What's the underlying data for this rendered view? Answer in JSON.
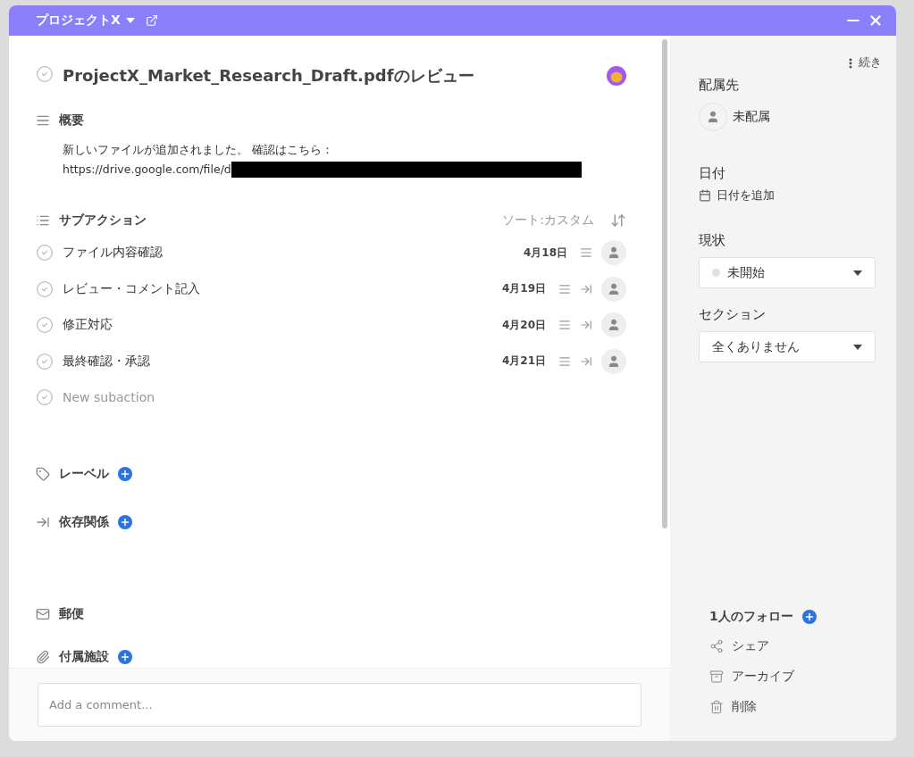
{
  "header": {
    "project": "プロジェクトX"
  },
  "task": {
    "title": "ProjectX_Market_Research_Draft.pdfのレビュー",
    "completed": false
  },
  "summary": {
    "label": "概要",
    "text": "新しいファイルが追加されました。 確認はこちら：",
    "link": "https://drive.google.com/file/d",
    "link_redacted": true
  },
  "subactions": {
    "label": "サブアクション",
    "sort": "ソート:カスタム",
    "new_placeholder": "New subaction",
    "items": [
      {
        "title": "ファイル内容確認",
        "date": "4月18日",
        "completed": false,
        "has_dependency": false
      },
      {
        "title": "レビュー・コメント記入",
        "date": "4月19日",
        "completed": false,
        "has_dependency": true
      },
      {
        "title": "修正対応",
        "date": "4月20日",
        "completed": false,
        "has_dependency": true
      },
      {
        "title": "最終確認・承認",
        "date": "4月21日",
        "completed": false,
        "has_dependency": true
      }
    ]
  },
  "sections": [
    {
      "kind": "labels",
      "title": "レーベル",
      "addable": true
    },
    {
      "kind": "dependencies",
      "title": "依存関係",
      "addable": true
    },
    {
      "kind": "mail",
      "title": "郵便",
      "addable": false
    },
    {
      "kind": "attachments",
      "title": "付属施設",
      "addable": true
    }
  ],
  "comment": {
    "placeholder": "Add a comment..."
  },
  "sidebar": {
    "more": "続き",
    "assignee": {
      "label": "配属先",
      "value": "未配属"
    },
    "date": {
      "label": "日付",
      "action": "日付を追加"
    },
    "status": {
      "label": "現状",
      "value": "未開始"
    },
    "section": {
      "label": "セクション",
      "value": "全くありません"
    },
    "followers": {
      "label": "1人のフォロー"
    },
    "actions": [
      {
        "kind": "share",
        "label": "シェア"
      },
      {
        "kind": "archive",
        "label": "アーカイブ"
      },
      {
        "kind": "delete",
        "label": "削除"
      }
    ]
  }
}
